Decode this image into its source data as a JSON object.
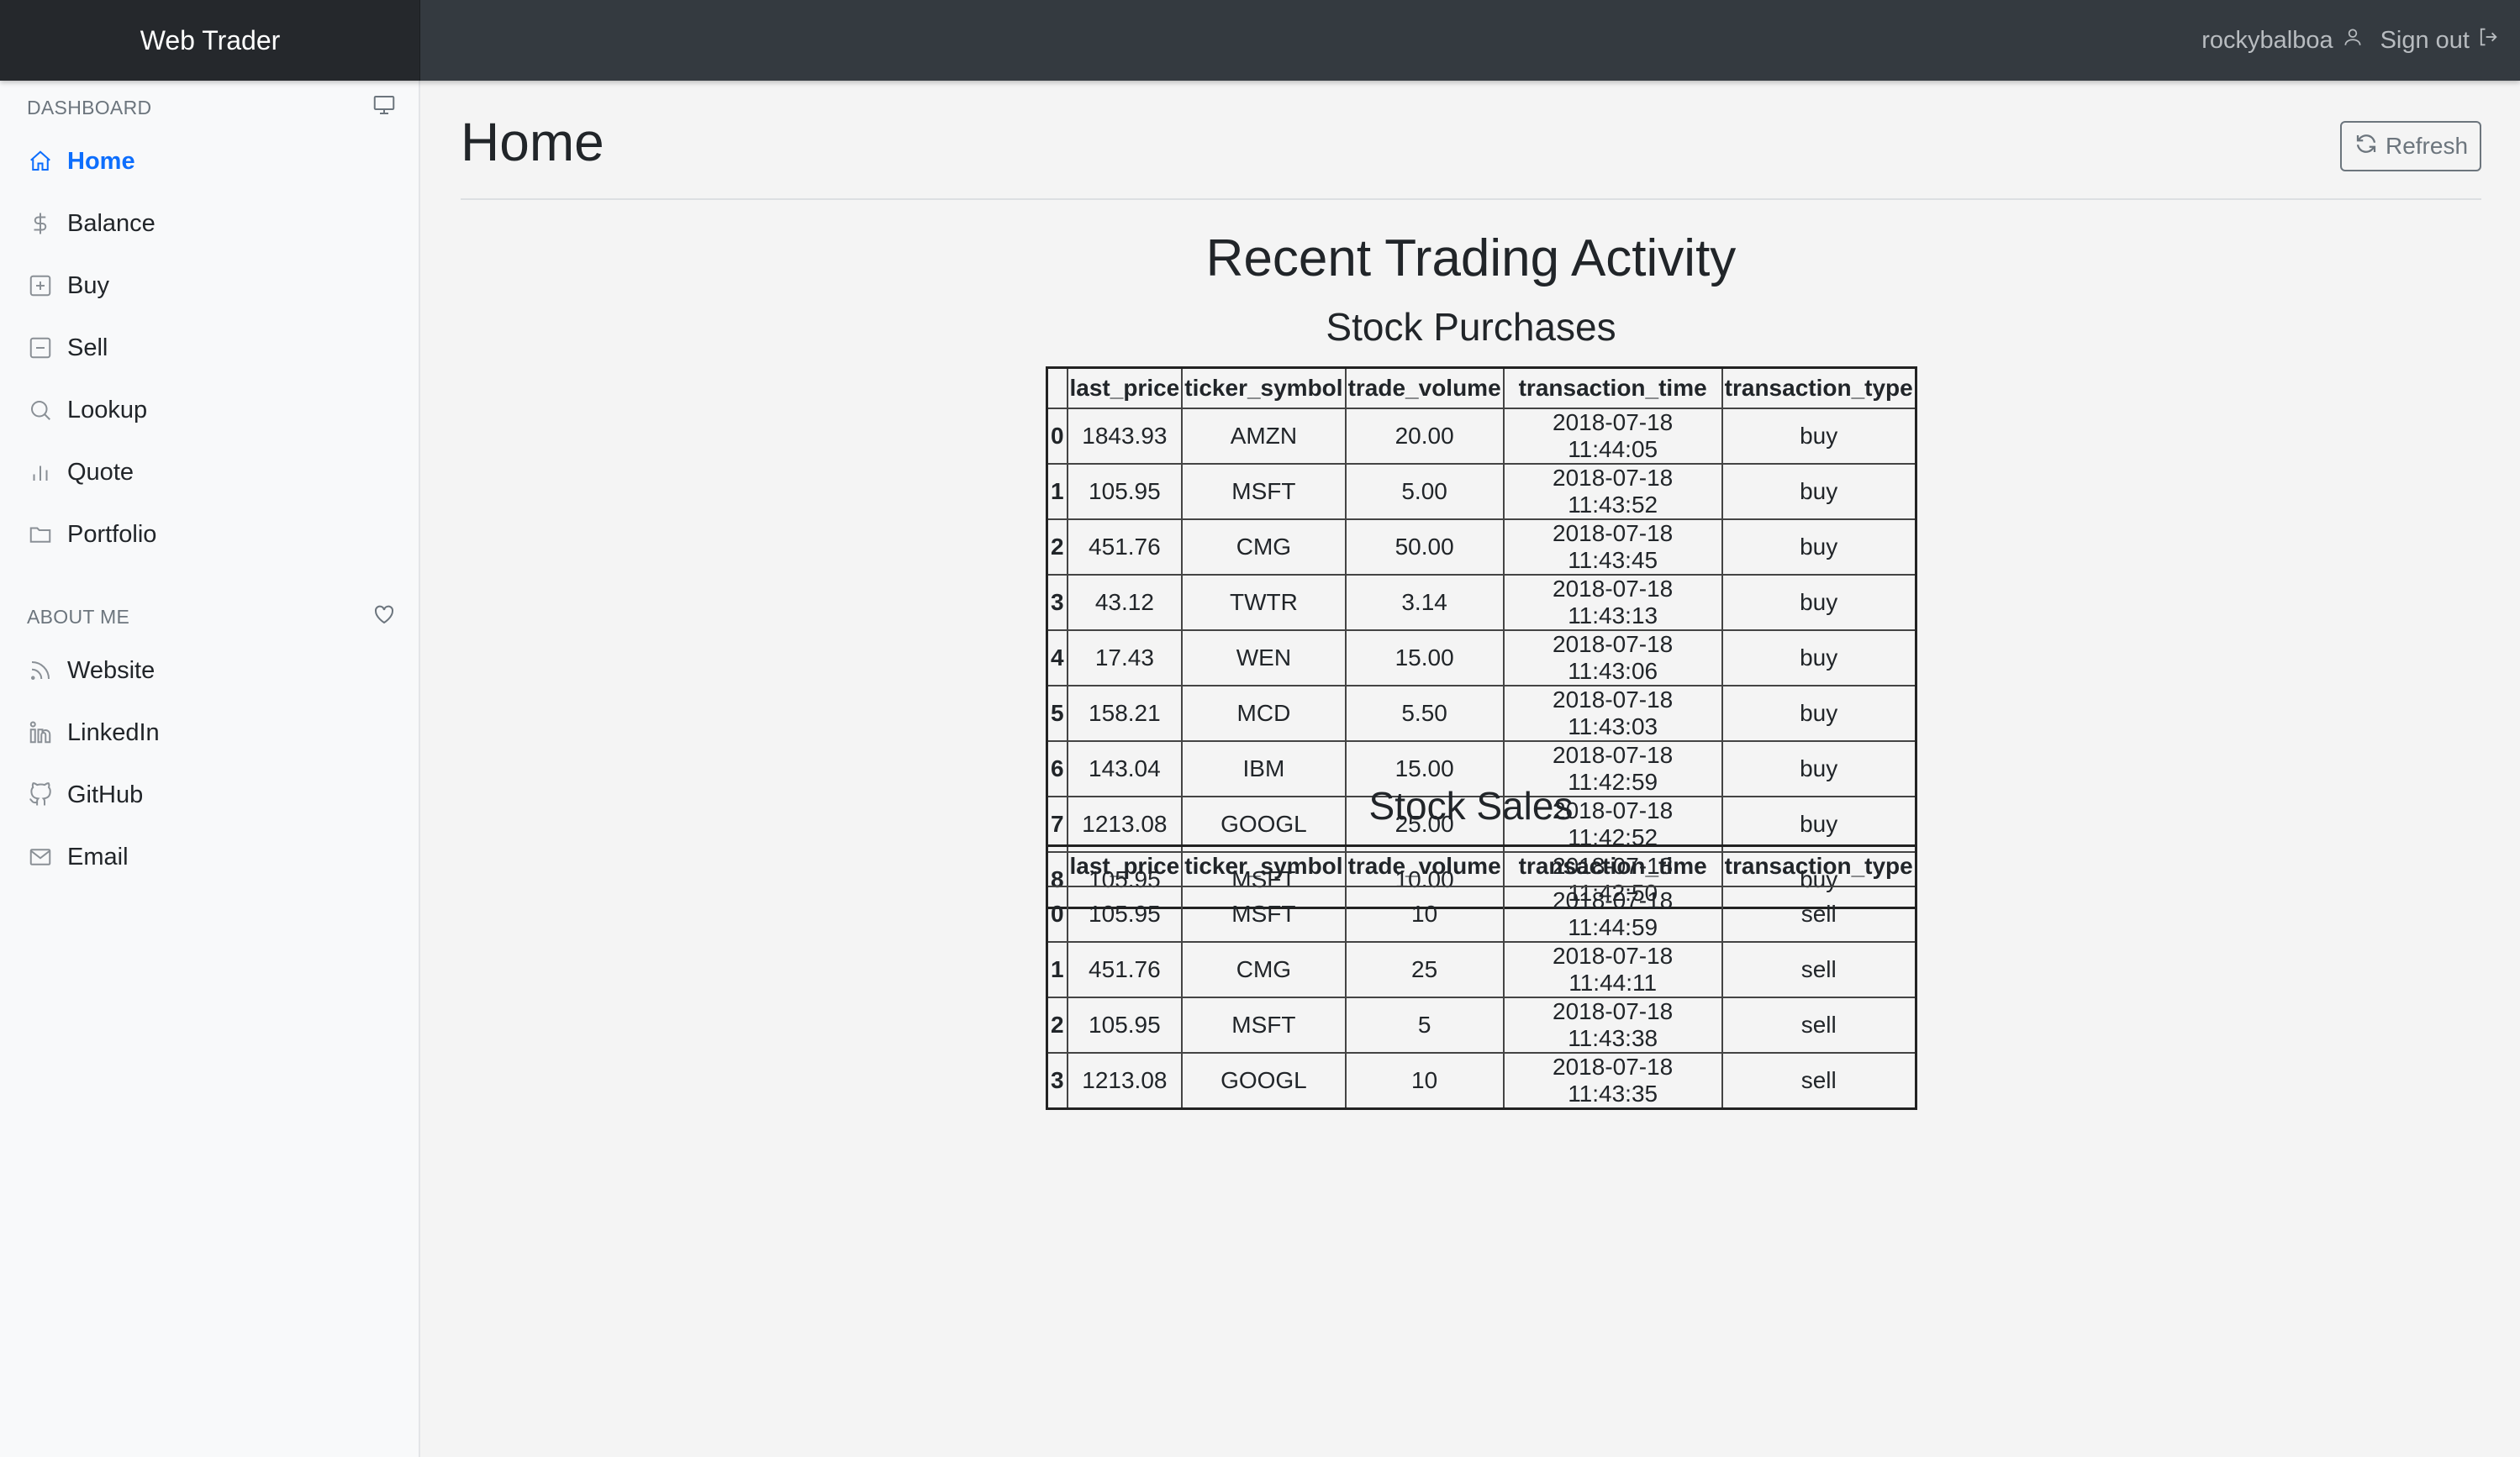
{
  "app": {
    "brand": "Web Trader"
  },
  "header": {
    "username": "rockybalboa",
    "signout_label": "Sign out"
  },
  "sidebar": {
    "dashboard_heading": "DASHBOARD",
    "dashboard_items": [
      {
        "label": "Home",
        "icon": "home-icon",
        "active": true
      },
      {
        "label": "Balance",
        "icon": "dollar-icon"
      },
      {
        "label": "Buy",
        "icon": "plus-square-icon"
      },
      {
        "label": "Sell",
        "icon": "minus-square-icon"
      },
      {
        "label": "Lookup",
        "icon": "search-icon"
      },
      {
        "label": "Quote",
        "icon": "bar-chart-icon"
      },
      {
        "label": "Portfolio",
        "icon": "folder-icon"
      }
    ],
    "about_heading": "ABOUT ME",
    "about_items": [
      {
        "label": "Website",
        "icon": "rss-icon"
      },
      {
        "label": "LinkedIn",
        "icon": "linkedin-icon"
      },
      {
        "label": "GitHub",
        "icon": "github-icon"
      },
      {
        "label": "Email",
        "icon": "mail-icon"
      }
    ]
  },
  "main": {
    "title": "Home",
    "refresh_label": "Refresh",
    "section_title": "Recent Trading Activity",
    "purchases_title": "Stock Purchases",
    "sales_title": "Stock Sales",
    "columns": [
      "",
      "last_price",
      "ticker_symbol",
      "trade_volume",
      "transaction_time",
      "transaction_type"
    ],
    "purchases": [
      [
        "0",
        "1843.93",
        "AMZN",
        "20.00",
        "2018-07-18 11:44:05",
        "buy"
      ],
      [
        "1",
        "105.95",
        "MSFT",
        "5.00",
        "2018-07-18 11:43:52",
        "buy"
      ],
      [
        "2",
        "451.76",
        "CMG",
        "50.00",
        "2018-07-18 11:43:45",
        "buy"
      ],
      [
        "3",
        "43.12",
        "TWTR",
        "3.14",
        "2018-07-18 11:43:13",
        "buy"
      ],
      [
        "4",
        "17.43",
        "WEN",
        "15.00",
        "2018-07-18 11:43:06",
        "buy"
      ],
      [
        "5",
        "158.21",
        "MCD",
        "5.50",
        "2018-07-18 11:43:03",
        "buy"
      ],
      [
        "6",
        "143.04",
        "IBM",
        "15.00",
        "2018-07-18 11:42:59",
        "buy"
      ],
      [
        "7",
        "1213.08",
        "GOOGL",
        "25.00",
        "2018-07-18 11:42:52",
        "buy"
      ],
      [
        "8",
        "105.95",
        "MSFT",
        "10.00",
        "2018-07-18 11:42:50",
        "buy"
      ]
    ],
    "sales": [
      [
        "0",
        "105.95",
        "MSFT",
        "10",
        "2018-07-18 11:44:59",
        "sell"
      ],
      [
        "1",
        "451.76",
        "CMG",
        "25",
        "2018-07-18 11:44:11",
        "sell"
      ],
      [
        "2",
        "105.95",
        "MSFT",
        "5",
        "2018-07-18 11:43:38",
        "sell"
      ],
      [
        "3",
        "1213.08",
        "GOOGL",
        "10",
        "2018-07-18 11:43:35",
        "sell"
      ]
    ]
  },
  "colors": {
    "active": "#0d6efd",
    "navbar": "#343a40",
    "brand_bg": "#25282c"
  }
}
